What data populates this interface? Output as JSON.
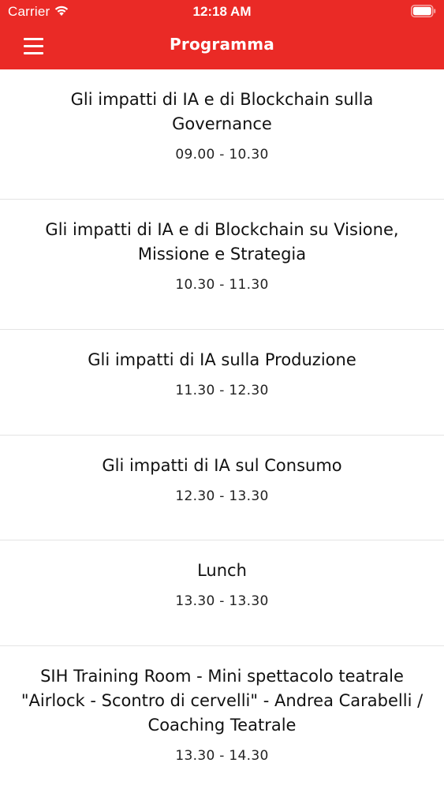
{
  "status_bar": {
    "carrier": "Carrier",
    "time": "12:18 AM",
    "wifi_icon": "wifi-icon",
    "battery_icon": "battery-icon"
  },
  "navbar": {
    "title": "Programma",
    "menu_icon": "hamburger-menu-icon",
    "background_color": "#ea2a26"
  },
  "program": [
    {
      "title": "Gli impatti di IA e di Blockchain sulla Governance",
      "time": "09.00 - 10.30"
    },
    {
      "title": "Gli impatti di IA e di Blockchain su Visione, Missione e Strategia",
      "time": "10.30 - 11.30"
    },
    {
      "title": "Gli impatti di IA sulla Produzione",
      "time": "11.30 - 12.30"
    },
    {
      "title": "Gli impatti di IA sul Consumo",
      "time": "12.30 - 13.30"
    },
    {
      "title": "Lunch",
      "time": "13.30 - 13.30"
    },
    {
      "title": "SIH Training Room - Mini spettacolo teatrale \"Airlock - Scontro di cervelli\" - Andrea Carabelli / Coaching Teatrale",
      "time": "13.30 - 14.30"
    }
  ]
}
